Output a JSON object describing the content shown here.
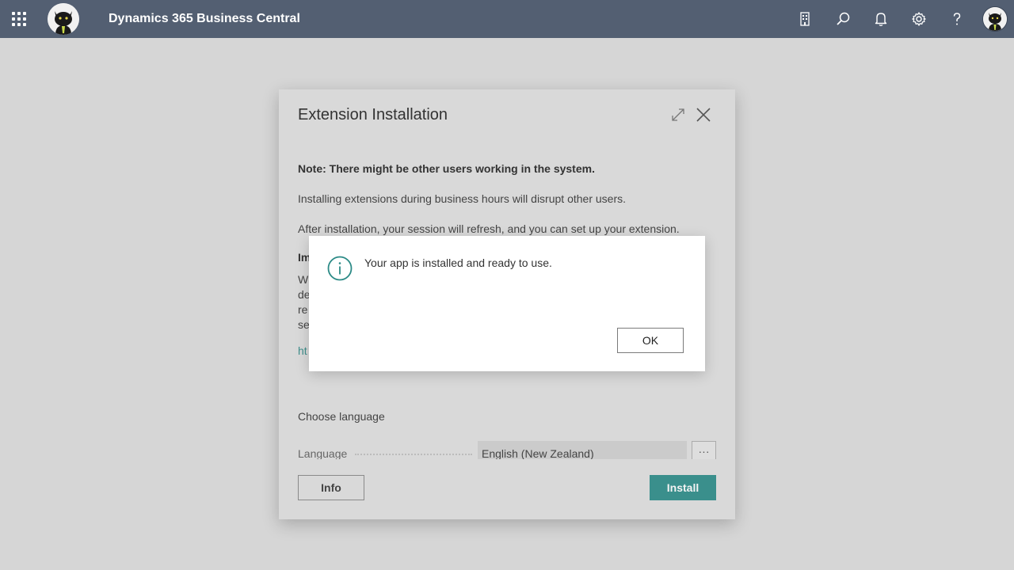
{
  "topbar": {
    "app_title": "Dynamics 365 Business Central",
    "background": "#535f72",
    "icons": [
      "app-launcher-icon",
      "company-icon",
      "search-icon",
      "bell-icon",
      "gear-icon",
      "help-icon"
    ]
  },
  "dialog": {
    "title": "Extension Installation",
    "note": "Note: There might be other users working in the system.",
    "para1": "Installing extensions during business hours will disrupt other users.",
    "para2": "After installation, your session will refresh, and you can set up your extension.",
    "hidden_fragments": {
      "important_heading": "Im",
      "line1": "W",
      "line2": "de",
      "line3": "re",
      "line4": "se",
      "link": "ht"
    },
    "choose_language": "Choose language",
    "language_label": "Language",
    "language_value": "English (New Zealand)",
    "language_more": "···",
    "info_button": "Info",
    "install_button": "Install",
    "accent": "#3a8f8c"
  },
  "message_box": {
    "text": "Your app is installed and ready to use.",
    "ok_button": "OK",
    "icon_color": "#2b8a86"
  }
}
